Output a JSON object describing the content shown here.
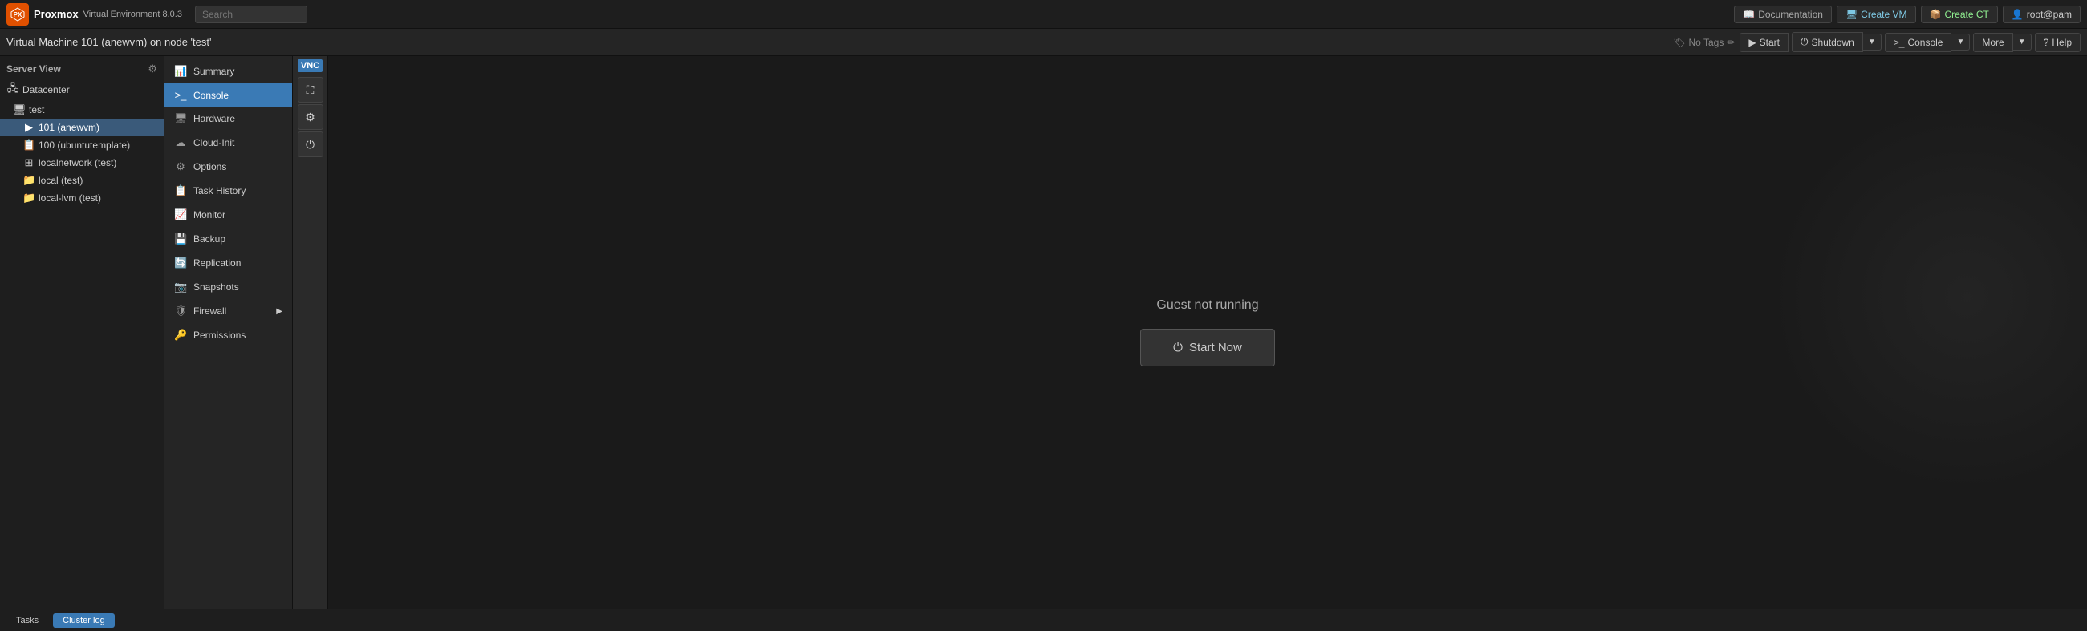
{
  "app": {
    "name": "Proxmox",
    "product": "Virtual Environment",
    "version": "8.0.3"
  },
  "topbar": {
    "search_placeholder": "Search",
    "docs_label": "Documentation",
    "create_vm_label": "Create VM",
    "create_ct_label": "Create CT",
    "user_label": "root@pam"
  },
  "secondbar": {
    "vm_title": "Virtual Machine 101 (anewvm) on node 'test'",
    "no_tags": "No Tags",
    "start_label": "Start",
    "shutdown_label": "Shutdown",
    "console_label": "Console",
    "more_label": "More",
    "help_label": "Help"
  },
  "sidebar": {
    "header": "Server View",
    "items": [
      {
        "label": "Datacenter",
        "icon": "🖧",
        "indent": 0,
        "type": "datacenter"
      },
      {
        "label": "test",
        "icon": "🖥",
        "indent": 1,
        "type": "node"
      },
      {
        "label": "101 (anewvm)",
        "icon": "▶",
        "indent": 2,
        "type": "vm",
        "active": true
      },
      {
        "label": "100 (ubuntutemplate)",
        "icon": "📋",
        "indent": 2,
        "type": "template"
      },
      {
        "label": "localnetwork (test)",
        "icon": "⊞",
        "indent": 2,
        "type": "network"
      },
      {
        "label": "local (test)",
        "icon": "📁",
        "indent": 2,
        "type": "storage"
      },
      {
        "label": "local-lvm (test)",
        "icon": "📁",
        "indent": 2,
        "type": "storage"
      }
    ]
  },
  "menu": {
    "items": [
      {
        "label": "Summary",
        "icon": "📊",
        "active": false
      },
      {
        "label": "Console",
        "icon": ">_",
        "active": true
      },
      {
        "label": "Hardware",
        "icon": "🖥",
        "active": false
      },
      {
        "label": "Cloud-Init",
        "icon": "☁",
        "active": false
      },
      {
        "label": "Options",
        "icon": "⚙",
        "active": false
      },
      {
        "label": "Task History",
        "icon": "📋",
        "active": false
      },
      {
        "label": "Monitor",
        "icon": "📈",
        "active": false
      },
      {
        "label": "Backup",
        "icon": "💾",
        "active": false
      },
      {
        "label": "Replication",
        "icon": "🔄",
        "active": false
      },
      {
        "label": "Snapshots",
        "icon": "📷",
        "active": false
      },
      {
        "label": "Firewall",
        "icon": "🛡",
        "active": false,
        "hasArrow": true
      },
      {
        "label": "Permissions",
        "icon": "🔑",
        "active": false
      }
    ]
  },
  "vnc": {
    "label": "VNC",
    "btn1_icon": "⬜",
    "btn2_icon": "⚙",
    "btn3_icon": "⏻"
  },
  "main": {
    "guest_not_running": "Guest not running",
    "start_now": "Start Now"
  },
  "bottombar": {
    "tasks_label": "Tasks",
    "cluster_label": "Cluster log"
  }
}
